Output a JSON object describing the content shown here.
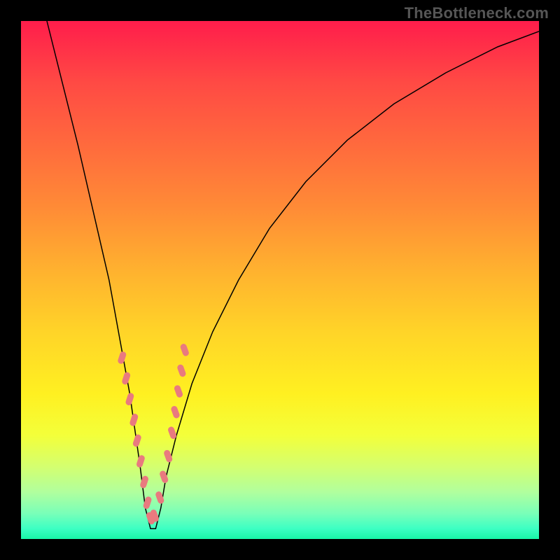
{
  "watermark": "TheBottleneck.com",
  "chart_data": {
    "type": "line",
    "title": "",
    "xlabel": "",
    "ylabel": "",
    "xlim": [
      0,
      100
    ],
    "ylim": [
      0,
      100
    ],
    "notes": "Bottleneck curve: deep narrow well near x≈25 (bottom), two branches rising steeply toward edges. Y increases upward (0 at bottom = green/good, 100 at top = red/bad). Dashed/beaded overlay highlights the lower-well walls.",
    "series": [
      {
        "name": "curve",
        "x": [
          5,
          8,
          11,
          14,
          17,
          19,
          21,
          23,
          24,
          25,
          26,
          27,
          28,
          30,
          33,
          37,
          42,
          48,
          55,
          63,
          72,
          82,
          92,
          100
        ],
        "values": [
          100,
          88,
          76,
          63,
          50,
          39,
          28,
          14,
          6,
          2,
          2,
          6,
          12,
          20,
          30,
          40,
          50,
          60,
          69,
          77,
          84,
          90,
          95,
          98
        ]
      },
      {
        "name": "beads",
        "x": [
          19.5,
          20.3,
          21.0,
          21.8,
          22.4,
          23.1,
          23.8,
          24.4,
          25.0,
          25.8,
          26.8,
          27.6,
          28.4,
          29.2,
          29.8,
          30.4,
          31.0,
          31.6
        ],
        "values": [
          35.0,
          31.0,
          27.0,
          23.0,
          19.0,
          15.0,
          11.0,
          7.0,
          4.0,
          4.5,
          8.0,
          12.0,
          16.0,
          20.5,
          24.5,
          28.5,
          32.5,
          36.5
        ]
      }
    ],
    "gradient_stops": [
      {
        "pos": 0.0,
        "color": "#ff1d4b"
      },
      {
        "pos": 0.36,
        "color": "#ff8b36"
      },
      {
        "pos": 0.72,
        "color": "#fff021"
      },
      {
        "pos": 1.0,
        "color": "#18f6a7"
      }
    ]
  }
}
